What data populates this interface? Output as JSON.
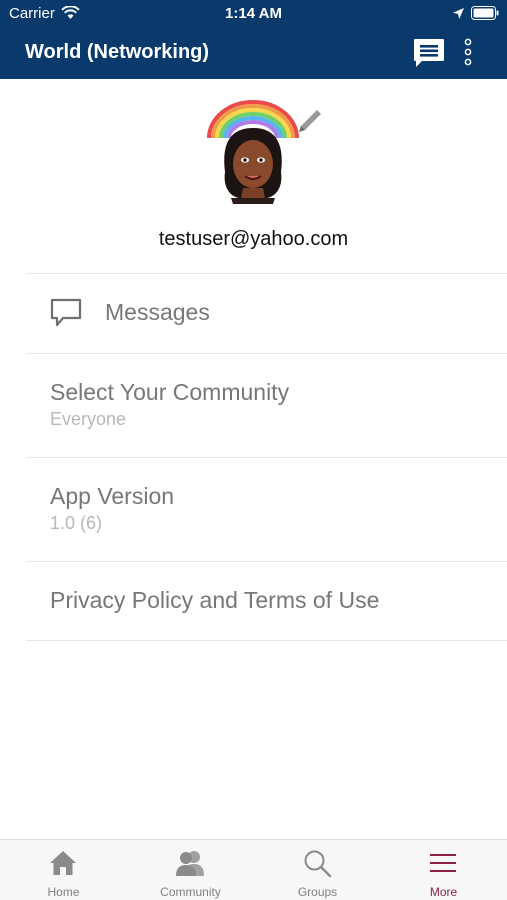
{
  "status_bar": {
    "carrier": "Carrier",
    "time": "1:14 AM"
  },
  "header": {
    "title": "World (Networking)"
  },
  "profile": {
    "email": "testuser@yahoo.com"
  },
  "menu": {
    "messages": {
      "label": "Messages"
    },
    "community": {
      "label": "Select Your Community",
      "value": "Everyone"
    },
    "version": {
      "label": "App Version",
      "value": "1.0 (6)"
    },
    "privacy": {
      "label": "Privacy Policy and Terms of Use"
    }
  },
  "tabs": [
    {
      "label": "Home",
      "icon": "home-icon",
      "active": false
    },
    {
      "label": "Community",
      "icon": "community-icon",
      "active": false
    },
    {
      "label": "Groups",
      "icon": "search-icon",
      "active": false
    },
    {
      "label": "More",
      "icon": "menu-icon",
      "active": true
    }
  ],
  "colors": {
    "header_bg": "#093a6b",
    "active_tab": "#8b2147",
    "inactive_tab": "#8a8a8a"
  }
}
